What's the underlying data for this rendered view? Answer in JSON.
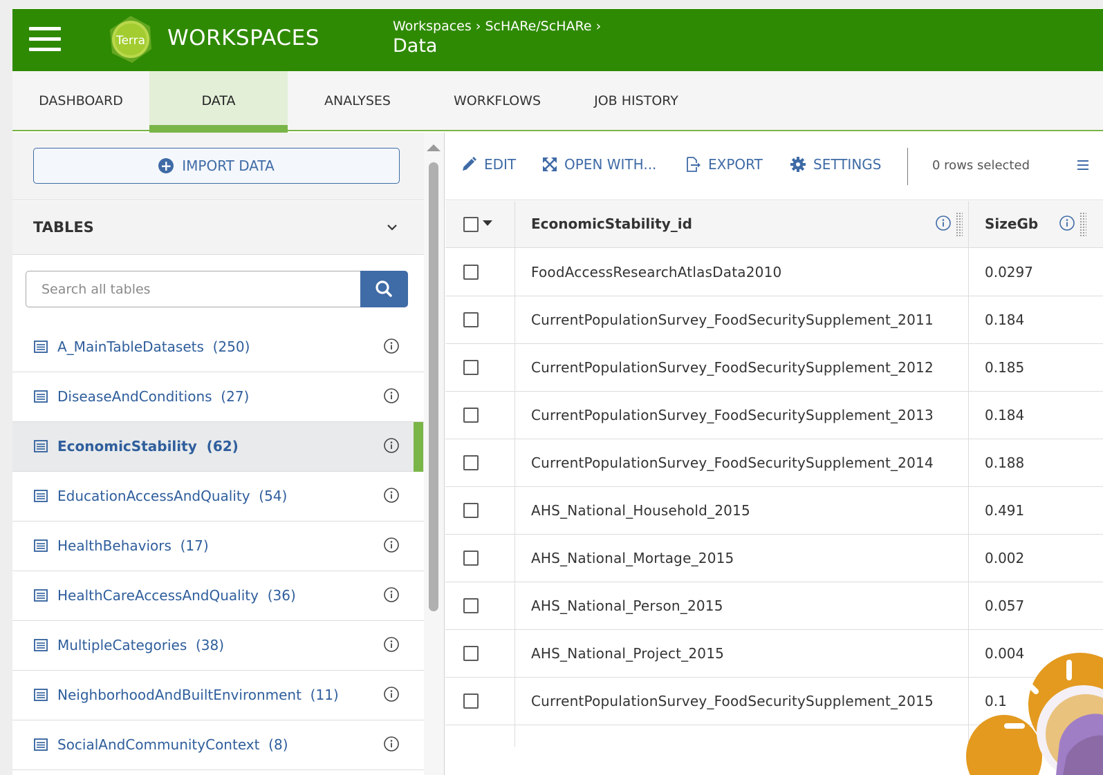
{
  "colors": {
    "brand_green": "#2f8a03",
    "accent_green": "#7ab547",
    "link_blue": "#3f6ba6"
  },
  "header": {
    "app_title": "WORKSPACES",
    "logo_text": "Terra",
    "breadcrumb": [
      "Workspaces",
      "ScHARe/ScHARe"
    ],
    "breadcrumb_sep": "›",
    "page_title": "Data"
  },
  "tabs": [
    {
      "label": "DASHBOARD",
      "active": false
    },
    {
      "label": "DATA",
      "active": true
    },
    {
      "label": "ANALYSES",
      "active": false
    },
    {
      "label": "WORKFLOWS",
      "active": false
    },
    {
      "label": "JOB HISTORY",
      "active": false
    }
  ],
  "left_panel": {
    "import_label": "IMPORT DATA",
    "tables_header": "TABLES",
    "search_placeholder": "Search all tables",
    "tables": [
      {
        "name": "A_MainTableDatasets",
        "count": "(250)"
      },
      {
        "name": "DiseaseAndConditions",
        "count": "(27)"
      },
      {
        "name": "EconomicStability",
        "count": "(62)",
        "selected": true
      },
      {
        "name": "EducationAccessAndQuality",
        "count": "(54)"
      },
      {
        "name": "HealthBehaviors",
        "count": "(17)"
      },
      {
        "name": "HealthCareAccessAndQuality",
        "count": "(36)"
      },
      {
        "name": "MultipleCategories",
        "count": "(38)"
      },
      {
        "name": "NeighborhoodAndBuiltEnvironment",
        "count": "(11)"
      },
      {
        "name": "SocialAndCommunityContext",
        "count": "(8)"
      }
    ]
  },
  "toolbar": {
    "edit": "EDIT",
    "open_with": "OPEN WITH...",
    "export": "EXPORT",
    "settings": "SETTINGS",
    "rows_selected": "0 rows selected"
  },
  "grid": {
    "columns": [
      "EconomicStability_id",
      "SizeGb"
    ],
    "rows": [
      {
        "id": "FoodAccessResearchAtlasData2010",
        "size": "0.0297"
      },
      {
        "id": "CurrentPopulationSurvey_FoodSecuritySupplement_2011",
        "size": "0.184"
      },
      {
        "id": "CurrentPopulationSurvey_FoodSecuritySupplement_2012",
        "size": "0.185"
      },
      {
        "id": "CurrentPopulationSurvey_FoodSecuritySupplement_2013",
        "size": "0.184"
      },
      {
        "id": "CurrentPopulationSurvey_FoodSecuritySupplement_2014",
        "size": "0.188"
      },
      {
        "id": "AHS_National_Household_2015",
        "size": "0.491"
      },
      {
        "id": "AHS_National_Mortage_2015",
        "size": "0.002"
      },
      {
        "id": "AHS_National_Person_2015",
        "size": "0.057"
      },
      {
        "id": "AHS_National_Project_2015",
        "size": "0.004"
      },
      {
        "id": "CurrentPopulationSurvey_FoodSecuritySupplement_2015",
        "size": "0.1"
      }
    ]
  }
}
